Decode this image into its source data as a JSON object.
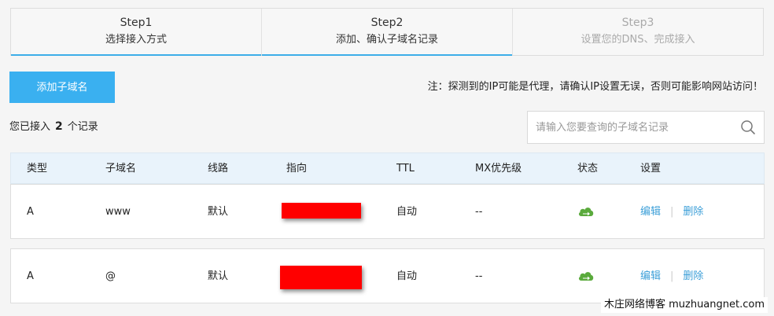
{
  "steps": [
    {
      "num": "Step1",
      "desc": "选择接入方式",
      "state": "done"
    },
    {
      "num": "Step2",
      "desc": "添加、确认子域名记录",
      "state": "active"
    },
    {
      "num": "Step3",
      "desc": "设置您的DNS、完成接入",
      "state": "pending"
    }
  ],
  "toolbar": {
    "add_label": "添加子域名",
    "notice": "注：探测到的IP可能是代理，请确认IP设置无误，否则可能影响网站访问！"
  },
  "summary": {
    "prefix": "您已接入",
    "count": "2",
    "suffix": "个记录"
  },
  "search": {
    "placeholder": "请输入您要查询的子域名记录",
    "icon": "search-icon"
  },
  "table": {
    "headers": {
      "type": "类型",
      "subdomain": "子域名",
      "line": "线路",
      "point": "指向",
      "ttl": "TTL",
      "mx": "MX优先级",
      "status": "状态",
      "setting": "设置"
    },
    "rows": [
      {
        "type": "A",
        "subdomain": "www",
        "line": "默认",
        "ttl": "自动",
        "mx": "--",
        "status_icon": "cloud-enabled-icon",
        "edit": "编辑",
        "delete": "删除"
      },
      {
        "type": "A",
        "subdomain": "@",
        "line": "默认",
        "ttl": "自动",
        "mx": "--",
        "status_icon": "cloud-enabled-icon",
        "edit": "编辑",
        "delete": "删除"
      }
    ]
  },
  "colors": {
    "accent": "#3ab0f0",
    "link": "#3c9fd8",
    "status_green": "#5aaa3c",
    "redaction": "#ff0000"
  },
  "watermark": "木庄网络博客 muzhuangnet.com"
}
